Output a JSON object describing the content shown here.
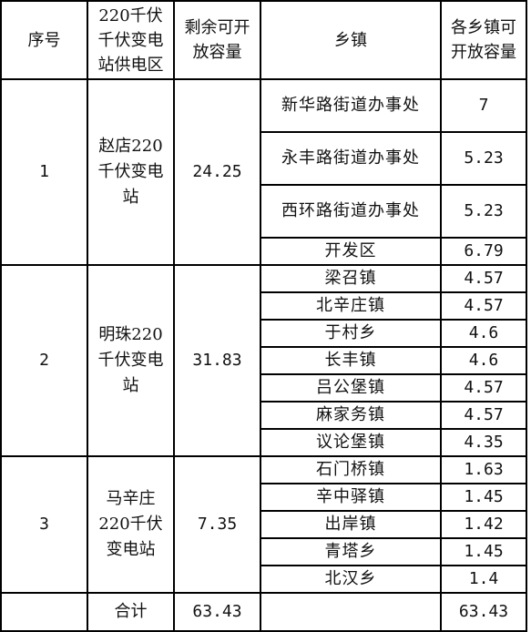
{
  "header": {
    "index": "序号",
    "substation": "220千伏\n千伏变电\n站供电区",
    "remaining_capacity": "剩余可开\n放容量",
    "town": "乡镇",
    "town_capacity": "各乡镇可\n开放容量"
  },
  "groups": [
    {
      "index": "1",
      "substation": "赵店220\n千伏变电\n站",
      "remaining_capacity": "24.25",
      "towns": [
        {
          "name": "新华路街道办事处",
          "capacity": "7"
        },
        {
          "name": "永丰路街道办事处",
          "capacity": "5.23"
        },
        {
          "name": "西环路街道办事处",
          "capacity": "5.23"
        },
        {
          "name": "开发区",
          "capacity": "6.79"
        }
      ]
    },
    {
      "index": "2",
      "substation": "明珠220\n千伏变电\n站",
      "remaining_capacity": "31.83",
      "towns": [
        {
          "name": "梁召镇",
          "capacity": "4.57"
        },
        {
          "name": "北辛庄镇",
          "capacity": "4.57"
        },
        {
          "name": "于村乡",
          "capacity": "4.6"
        },
        {
          "name": "长丰镇",
          "capacity": "4.6"
        },
        {
          "name": "吕公堡镇",
          "capacity": "4.57"
        },
        {
          "name": "麻家务镇",
          "capacity": "4.57"
        },
        {
          "name": "议论堡镇",
          "capacity": "4.35"
        }
      ]
    },
    {
      "index": "3",
      "substation": "马辛庄\n220千伏\n变电站",
      "remaining_capacity": "7.35",
      "towns": [
        {
          "name": "石门桥镇",
          "capacity": "1.63"
        },
        {
          "name": "辛中驿镇",
          "capacity": "1.45"
        },
        {
          "name": "出岸镇",
          "capacity": "1.42"
        },
        {
          "name": "青塔乡",
          "capacity": "1.45"
        },
        {
          "name": "北汉乡",
          "capacity": "1.4"
        }
      ]
    }
  ],
  "total": {
    "label": "合计",
    "remaining_capacity": "63.43",
    "town_capacity": "63.43"
  }
}
